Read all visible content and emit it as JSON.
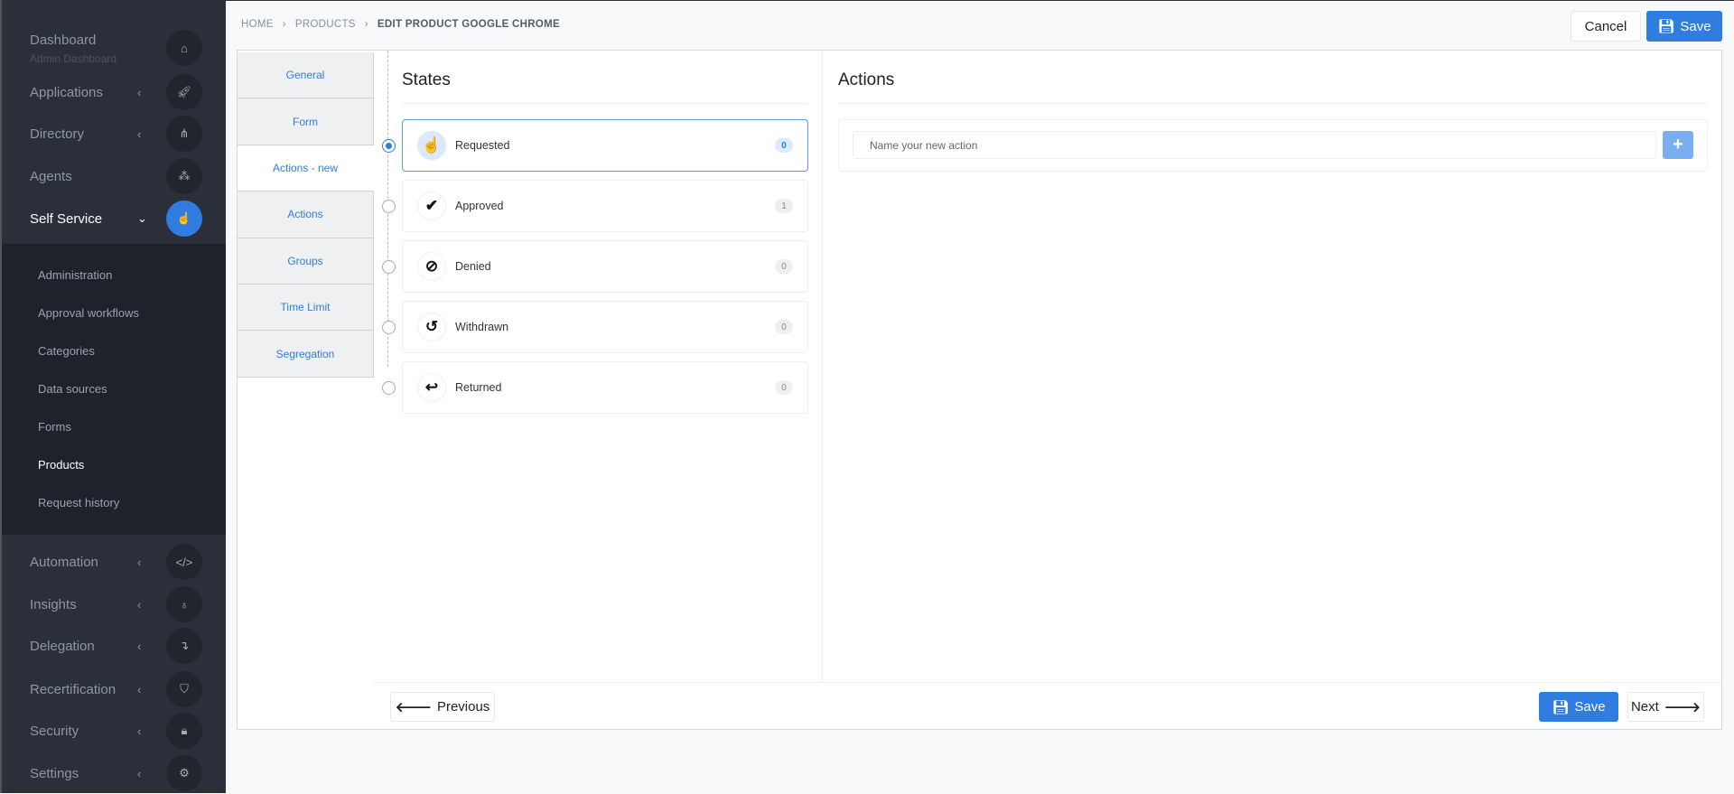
{
  "sidebar": {
    "items": [
      {
        "label": "Dashboard",
        "sub": "Admin Dashboard",
        "icon": "home-icon",
        "glyph": "⌂"
      },
      {
        "label": "Applications",
        "icon": "rocket-icon",
        "glyph": "🚀︎"
      },
      {
        "label": "Directory",
        "icon": "sitemap-icon",
        "glyph": "⋔"
      },
      {
        "label": "Agents",
        "icon": "cubes-icon",
        "glyph": "⁂"
      },
      {
        "label": "Self Service",
        "icon": "hand-pointer-icon",
        "glyph": "☝"
      },
      {
        "label": "Automation",
        "icon": "code-icon",
        "glyph": "</>"
      },
      {
        "label": "Insights",
        "icon": "lightbulb-icon",
        "glyph": "♁"
      },
      {
        "label": "Delegation",
        "icon": "level-down-icon",
        "glyph": "↴"
      },
      {
        "label": "Recertification",
        "icon": "shield-icon",
        "glyph": "⛉"
      },
      {
        "label": "Security",
        "icon": "lock-icon",
        "glyph": "🔒︎"
      },
      {
        "label": "Settings",
        "icon": "cog-icon",
        "glyph": "⚙"
      }
    ],
    "submenu": [
      "Administration",
      "Approval workflows",
      "Categories",
      "Data sources",
      "Forms",
      "Products",
      "Request history"
    ],
    "active_sub": "Products"
  },
  "breadcrumb": [
    "HOME",
    "PRODUCTS",
    "EDIT PRODUCT GOOGLE CHROME"
  ],
  "header": {
    "cancel": "Cancel",
    "save": "Save"
  },
  "tabs": [
    "General",
    "Form",
    "Actions - new",
    "Actions",
    "Groups",
    "Time Limit",
    "Segregation"
  ],
  "active_tab": "Actions - new",
  "states": {
    "title": "States",
    "items": [
      {
        "name": "Requested",
        "count": "0",
        "icon": "hand-pointer-icon",
        "glyph": "☝"
      },
      {
        "name": "Approved",
        "count": "1",
        "icon": "check-icon",
        "glyph": "✔"
      },
      {
        "name": "Denied",
        "count": "0",
        "icon": "ban-icon",
        "glyph": "⊘"
      },
      {
        "name": "Withdrawn",
        "count": "0",
        "icon": "undo-icon",
        "glyph": "↺"
      },
      {
        "name": "Returned",
        "count": "0",
        "icon": "reply-icon",
        "glyph": "↩"
      }
    ]
  },
  "actions": {
    "title": "Actions",
    "placeholder": "Name your new action"
  },
  "footer": {
    "previous": "Previous",
    "save": "Save",
    "next": "Next"
  },
  "colors": {
    "accent": "#2f7de1",
    "sidebar": "#2b2f3a"
  }
}
